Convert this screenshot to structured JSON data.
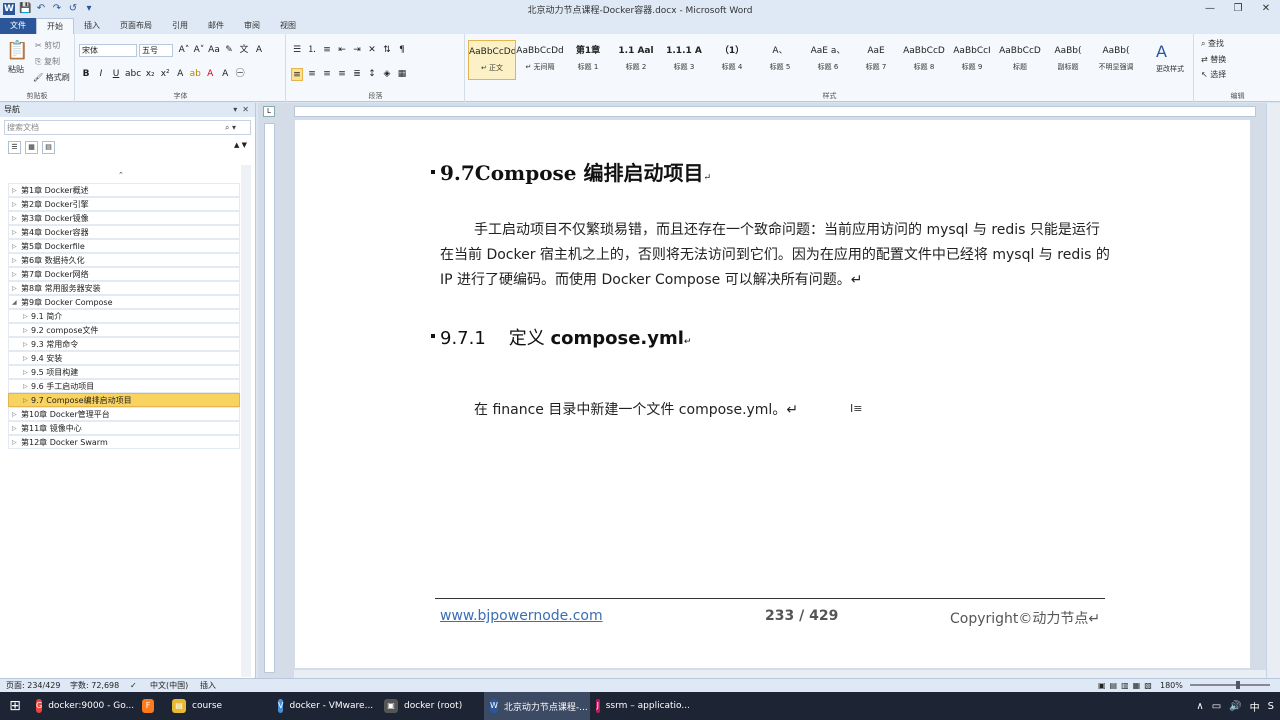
{
  "window": {
    "title": "北京动力节点课程-Docker容器.docx - Microsoft Word",
    "controls": [
      "—",
      "❐",
      "✕"
    ]
  },
  "qat_icons": [
    "W",
    "💾",
    "↶",
    "↷",
    "↺",
    "▾"
  ],
  "ribbon_tabs": [
    "文件",
    "开始",
    "插入",
    "页面布局",
    "引用",
    "邮件",
    "审阅",
    "视图"
  ],
  "ribbon": {
    "clipboard": {
      "paste": "粘贴",
      "cut": "剪切",
      "copy": "复制",
      "format_painter": "格式刷",
      "label": "剪贴板"
    },
    "font": {
      "font_name": "宋体",
      "font_size": "五号",
      "label": "字体"
    },
    "paragraph": {
      "label": "段落"
    },
    "styles": {
      "label": "样式",
      "items": [
        {
          "preview": "AaBbCcDd",
          "name": "↵ 正文"
        },
        {
          "preview": "AaBbCcDd",
          "name": "↵ 无间隔"
        },
        {
          "preview": "第1章",
          "name": "标题 1"
        },
        {
          "preview": "1.1 Aal",
          "name": "标题 2"
        },
        {
          "preview": "1.1.1 A",
          "name": "标题 3"
        },
        {
          "preview": "（1）",
          "name": "标题 4"
        },
        {
          "preview": "A、",
          "name": "标题 5"
        },
        {
          "preview": "AaE a、",
          "name": "标题 6"
        },
        {
          "preview": "AaE",
          "name": "标题 7"
        },
        {
          "preview": "AaBbCcD",
          "name": "标题 8"
        },
        {
          "preview": "AaBbCcI",
          "name": "标题 9"
        },
        {
          "preview": "AaBbCcD",
          "name": "标题"
        },
        {
          "preview": "AaBb(",
          "name": "副标题"
        },
        {
          "preview": "AaBb(",
          "name": "不明显强调"
        }
      ],
      "change_styles": "更改样式"
    },
    "editing": {
      "find": "查找",
      "replace": "替换",
      "select": "选择",
      "label": "编辑"
    }
  },
  "nav": {
    "title": "导航",
    "search_placeholder": "搜索文档",
    "items": [
      {
        "label": "第1章 Docker概述",
        "level": 1
      },
      {
        "label": "第2章  Docker引擎",
        "level": 1
      },
      {
        "label": "第3章 Docker镜像",
        "level": 1
      },
      {
        "label": "第4章 Docker容器",
        "level": 1
      },
      {
        "label": "第5章 Dockerfile",
        "level": 1
      },
      {
        "label": "第6章 数据持久化",
        "level": 1
      },
      {
        "label": "第7章 Docker网络",
        "level": 1
      },
      {
        "label": "第8章 常用服务器安装",
        "level": 1
      },
      {
        "label": "第9章 Docker Compose",
        "level": 1,
        "expanded": true
      },
      {
        "label": "9.1 简介",
        "level": 2
      },
      {
        "label": "9.2 compose文件",
        "level": 2
      },
      {
        "label": "9.3 常用命令",
        "level": 2
      },
      {
        "label": "9.4 安装",
        "level": 2
      },
      {
        "label": "9.5 项目构建",
        "level": 2
      },
      {
        "label": "9.6 手工启动项目",
        "level": 2
      },
      {
        "label": "9.7 Compose编排启动项目",
        "level": 2,
        "selected": true
      },
      {
        "label": "第10章 Docker管理平台",
        "level": 1
      },
      {
        "label": "第11章 镜像中心",
        "level": 1
      },
      {
        "label": "第12章 Docker Swarm",
        "level": 1
      }
    ]
  },
  "document": {
    "heading": "9.7Compose 编排启动项目",
    "heading_mark": "↵",
    "paragraph": "手工启动项目不仅繁琐易错，而且还存在一个致命问题：当前应用访问的 mysql 与 redis 只能是运行在当前 Docker 宿主机之上的，否则将无法访问到它们。因为在应用的配置文件中已经将 mysql 与 redis 的 IP 进行了硬编码。而使用 Docker Compose 可以解决所有问题。↵",
    "subheading_num": "9.7.1",
    "subheading_text_cn": "定义",
    "subheading_text_en": "compose.yml",
    "subheading_mark": "↵",
    "paragraph2": "在 finance 目录中新建一个文件 compose.yml。↵",
    "footer": {
      "link": "www.bjpowernode.com",
      "page": "233 / 429",
      "copyright": "Copyright©动力节点↵"
    }
  },
  "statusbar": {
    "page": "页面: 234/429",
    "words": "字数: 72,698",
    "language": "中文(中国)",
    "mode": "插入",
    "zoom": "180%",
    "zoom_fraction": 0.58
  },
  "taskbar": {
    "items": [
      {
        "label": "docker:9000 - Go...",
        "color": "#e8453c",
        "icon": "G"
      },
      {
        "label": "",
        "color": "#ff7a1a",
        "icon": "F"
      },
      {
        "label": "course",
        "color": "#e8b933",
        "icon": "▤"
      },
      {
        "label": "docker - VMware...",
        "color": "#4a8fd6",
        "icon": "V"
      },
      {
        "label": "docker (root)",
        "color": "#555",
        "icon": "▣"
      },
      {
        "label": "北京动力节点课程-...",
        "color": "#2b579a",
        "icon": "W",
        "active": true
      },
      {
        "label": "ssrm – applicatio...",
        "color": "#c2185b",
        "icon": "J"
      }
    ],
    "tray": [
      "∧",
      "▭",
      "🔊",
      "中",
      "S"
    ]
  }
}
